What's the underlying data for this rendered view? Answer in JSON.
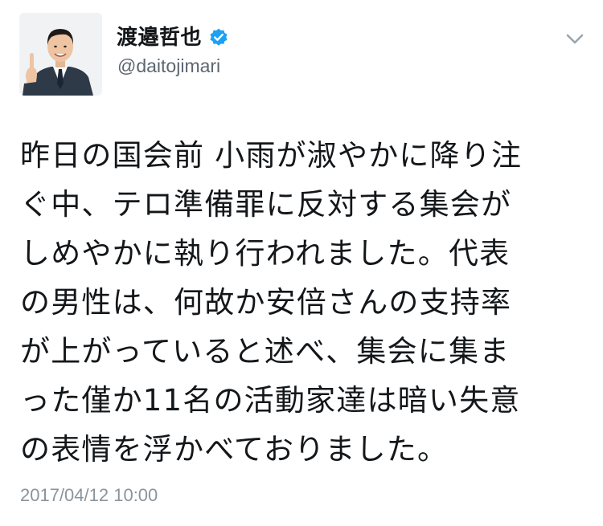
{
  "author": {
    "display_name": "渡邉哲也",
    "screen_name": "@daitojimari",
    "verified": true,
    "avatar_icon": "profile-photo-man-in-suit"
  },
  "menu": {
    "icon": "chevron-down-icon"
  },
  "tweet": {
    "text_lines": [
      "昨日の国会前 小雨が淑やかに降り注",
      "ぐ中、テロ準備罪に反対する集会が",
      "しめやかに執り行われました。代表",
      "の男性は、何故か安倍さんの支持率",
      "が上がっていると述べ、集会に集ま",
      "った僅か11名の活動家達は暗い失意",
      "の表情を浮かべておりました。"
    ],
    "timestamp": "2017/04/12 10:00"
  },
  "colors": {
    "verified_blue": "#1da1f2",
    "text_primary": "#14171a",
    "text_secondary": "#5b6670",
    "timestamp": "#8a949c",
    "chevron": "#9aa5ad"
  }
}
